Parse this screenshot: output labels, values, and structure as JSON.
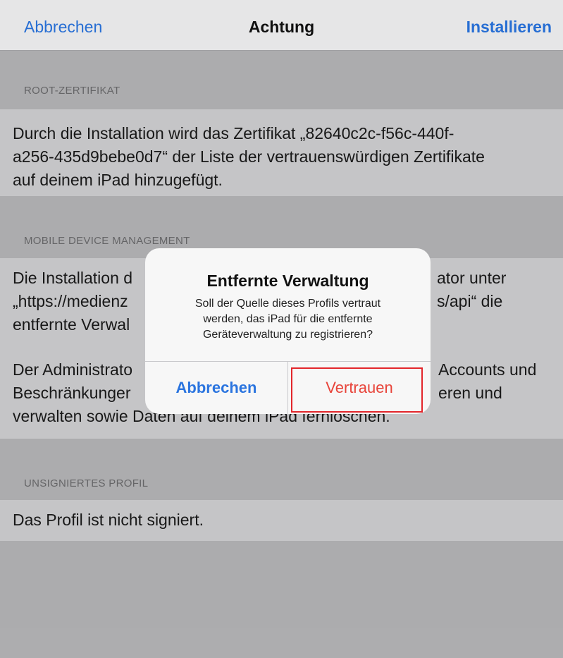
{
  "navbar": {
    "cancel_label": "Abbrechen",
    "title": "Achtung",
    "install_label": "Installieren"
  },
  "sections": [
    {
      "header": "ROOT-ZERTIFIKAT",
      "lines": [
        "Durch die Installation wird das Zertifikat „82640c2c-f56c-440f-",
        "a256-435d9bebe0d7“ der Liste der vertrauenswürdigen Zertifikate",
        "auf deinem iPad hinzugefügt."
      ]
    },
    {
      "header": "MOBILE DEVICE MANAGEMENT",
      "paragraph1_lines": [
        "Die Installation d",
        "„https://medienz",
        "entfernte Verwal"
      ],
      "paragraph1_right_lines": [
        "ator unter",
        "s/api“ die"
      ],
      "paragraph2_lines": [
        "Der Administrato",
        "Beschränkunger"
      ],
      "paragraph2_right_lines": [
        "Accounts und",
        "eren und"
      ],
      "paragraph2_last_line": "verwalten sowie Daten auf deinem iPad fernlöschen."
    },
    {
      "header": "UNSIGNIERTES PROFIL",
      "lines": [
        "Das Profil ist nicht signiert."
      ]
    }
  ],
  "alert": {
    "title": "Entfernte Verwaltung",
    "message_lines": [
      "Soll der Quelle dieses Profils vertraut",
      "werden, das iPad für die entfernte",
      "Geräteverwaltung zu registrieren?"
    ],
    "cancel_label": "Abbrechen",
    "trust_label": "Vertrauen"
  },
  "colors": {
    "accent_blue": "#2a74df",
    "destructive_red": "#e8443a",
    "highlight_red": "#e3262b"
  }
}
